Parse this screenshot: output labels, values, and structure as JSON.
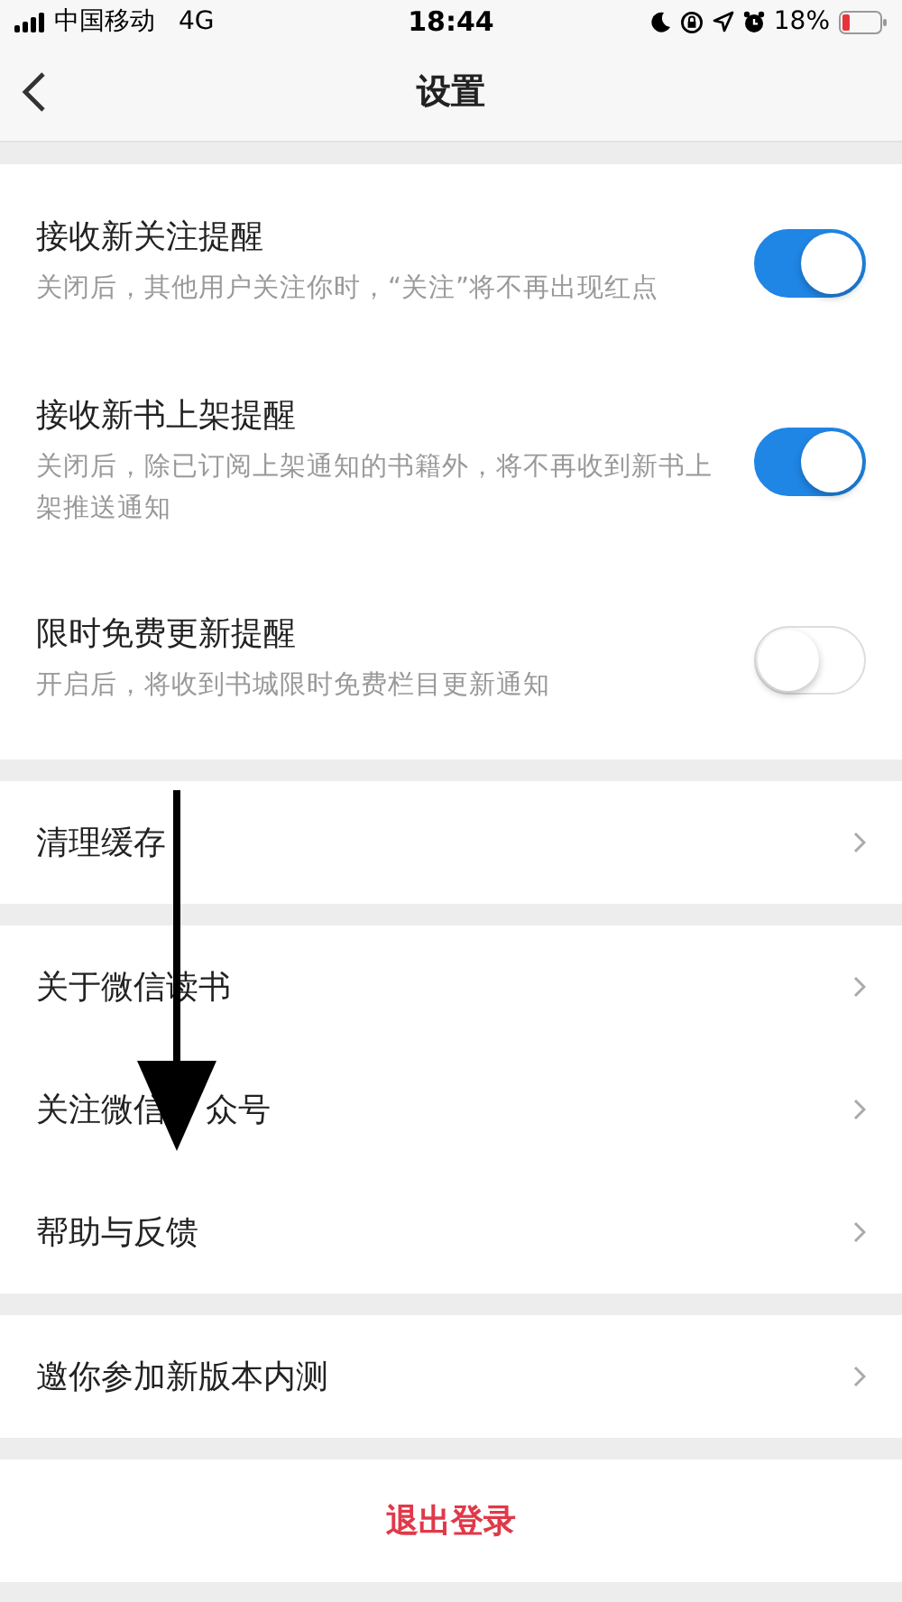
{
  "status_bar": {
    "carrier": "中国移动",
    "network": "4G",
    "time": "18:44",
    "battery": "18%"
  },
  "nav": {
    "title": "设置"
  },
  "notification_settings": [
    {
      "title": "接收新关注提醒",
      "description": "关闭后，其他用户关注你时，“关注”将不再出现红点",
      "on": true
    },
    {
      "title": "接收新书上架提醒",
      "description": "关闭后，除已订阅上架通知的书籍外，将不再收到新书上架推送通知",
      "on": true
    },
    {
      "title": "限时免费更新提醒",
      "description": "开启后，将收到书城限时免费栏目更新通知",
      "on": false
    }
  ],
  "groups": [
    [
      {
        "label": "清理缓存"
      }
    ],
    [
      {
        "label": "关于微信读书"
      },
      {
        "label_parts": [
          "关注微信",
          "众号"
        ]
      },
      {
        "label": "帮助与反馈"
      }
    ],
    [
      {
        "label": "邀你参加新版本内测"
      }
    ]
  ],
  "logout": {
    "label": "退出登录"
  }
}
